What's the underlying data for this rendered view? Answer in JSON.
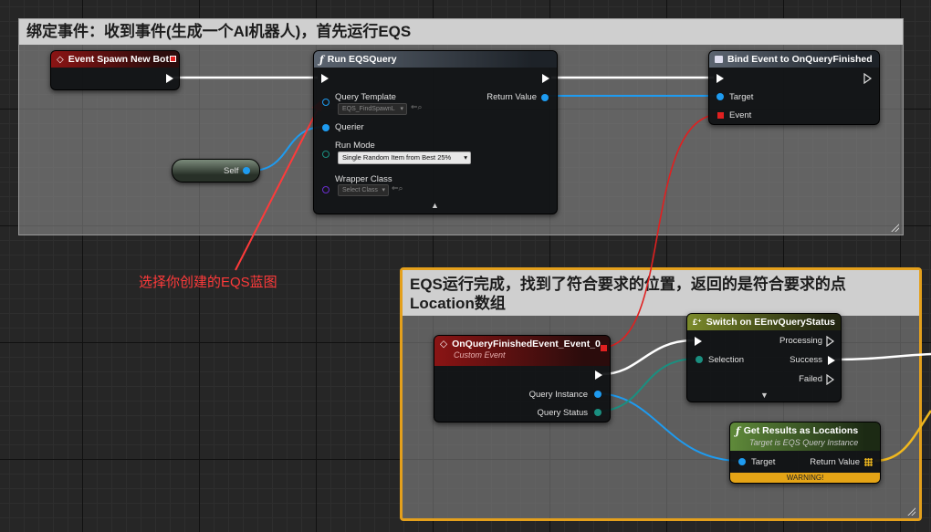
{
  "comment_top": {
    "title": "绑定事件：收到事件(生成一个AI机器人)，首先运行EQS"
  },
  "comment_bottom": {
    "title_line1": "EQS运行完成，找到了符合要求的位置，返回的是符合要求的点",
    "title_line2": "Location数组"
  },
  "annotation": "选择你创建的EQS蓝图",
  "event_spawn": {
    "title": "Event Spawn New Bot"
  },
  "run_eqs": {
    "title": "Run EQSQuery",
    "query_template_label": "Query Template",
    "query_template_value": "EQS_FindSpawnL",
    "querier_label": "Querier",
    "run_mode_label": "Run Mode",
    "run_mode_value": "Single Random Item from Best 25%",
    "wrapper_label": "Wrapper Class",
    "wrapper_value": "Select Class",
    "return_label": "Return Value"
  },
  "self_node": {
    "label": "Self"
  },
  "bind_event": {
    "title": "Bind Event to OnQueryFinished",
    "target_label": "Target",
    "event_label": "Event"
  },
  "custom_event": {
    "title": "OnQueryFinishedEvent_Event_0",
    "subtitle": "Custom Event",
    "query_instance_label": "Query Instance",
    "query_status_label": "Query Status"
  },
  "switch_node": {
    "title": "Switch on EEnvQueryStatus",
    "selection_label": "Selection",
    "processing_label": "Processing",
    "success_label": "Success",
    "failed_label": "Failed"
  },
  "get_results": {
    "title": "Get Results as Locations",
    "subtitle": "Target is EQS Query Instance",
    "target_label": "Target",
    "return_label": "Return Value",
    "warning": "WARNING!"
  },
  "icons": [
    "event-diamond-icon",
    "function-icon",
    "bind-event-icon",
    "switch-icon",
    "exec-pin-icon",
    "data-pin-icon",
    "dropdown-arrow-icon",
    "browse-icon",
    "expand-arrow-icon",
    "resize-handle-icon"
  ],
  "colors": {
    "exec": "#ffffff",
    "object_pin": "#1e9bf0",
    "struct_pin": "#1a8f80",
    "delegate_pin": "#e02020",
    "vector_array": "#f0b81e",
    "comment_selected": "#e4a01c",
    "annotation": "#ff3a3a"
  }
}
